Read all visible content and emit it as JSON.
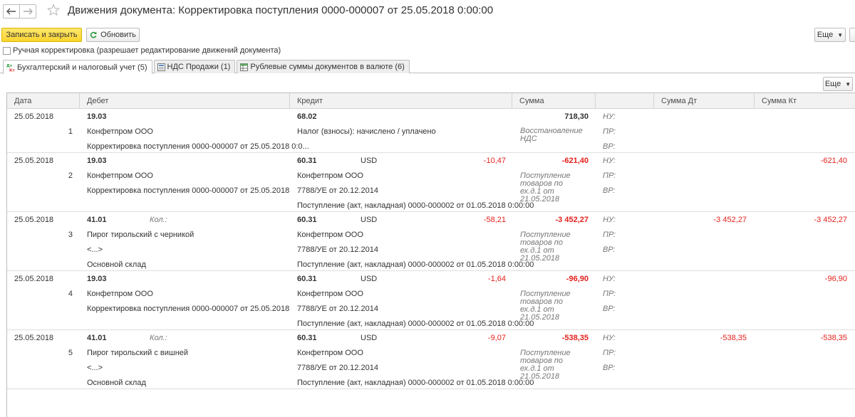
{
  "window": {
    "title": "Движения документа: Корректировка поступления 0000-000007 от 25.05.2018 0:00:00"
  },
  "toolbar": {
    "save_close": "Записать и закрыть",
    "refresh": "Обновить",
    "more": "Еще"
  },
  "manual_correction": {
    "label": "Ручная корректировка (разрешает редактирование движений документа)",
    "checked": false
  },
  "tabs": [
    {
      "label": "Бухгалтерский и налоговый учет (5)",
      "active": true,
      "icon": "accounting-icon"
    },
    {
      "label": "НДС Продажи (1)",
      "active": false,
      "icon": "register-icon"
    },
    {
      "label": "Рублевые суммы документов в валюте (6)",
      "active": false,
      "icon": "table-icon"
    }
  ],
  "table": {
    "more": "Еще",
    "columns": [
      "Дата",
      "Дебет",
      "Кредит",
      "Сумма",
      "",
      "Сумма Дт",
      "Сумма Кт"
    ],
    "rows": [
      {
        "date": "25.05.2018",
        "num": "1",
        "dt_account": "19.03",
        "dt_qty": "",
        "dt_sub": [
          "Конфетпром ООО",
          "Корректировка поступления 0000-000007 от 25.05.2018 0:0..."
        ],
        "kt_account": "68.02",
        "kt_currency": "",
        "kt_cur_amount": "",
        "kt_sub": [
          "Налог (взносы): начислено / уплачено"
        ],
        "amount": "718,30",
        "amount_red": false,
        "content": "Восстановление НДС",
        "nu": "НУ:",
        "pr": "ПР:",
        "vr": "ВР:",
        "sum_dt": "",
        "sum_kt": ""
      },
      {
        "date": "25.05.2018",
        "num": "2",
        "dt_account": "19.03",
        "dt_qty": "",
        "dt_sub": [
          "Конфетпром ООО",
          "Корректировка поступления 0000-000007 от 25.05.2018"
        ],
        "kt_account": "60.31",
        "kt_currency": "USD",
        "kt_cur_amount": "-10,47",
        "kt_sub": [
          "Конфетпром ООО",
          "7788/УЕ от 20.12.2014",
          "Поступление (акт, накладная) 0000-000002 от 01.05.2018 0:00:00"
        ],
        "amount": "-621,40",
        "amount_red": true,
        "content": "Поступление товаров по ех.д.1 от 21.05.2018",
        "nu": "НУ:",
        "pr": "ПР:",
        "vr": "ВР:",
        "sum_dt": "",
        "sum_kt": "-621,40"
      },
      {
        "date": "25.05.2018",
        "num": "3",
        "dt_account": "41.01",
        "dt_qty": "Кол.:",
        "dt_sub": [
          "Пирог тирольский с черникой",
          "<...>",
          "Основной склад"
        ],
        "kt_account": "60.31",
        "kt_currency": "USD",
        "kt_cur_amount": "-58,21",
        "kt_sub": [
          "Конфетпром ООО",
          "7788/УЕ от 20.12.2014",
          "Поступление (акт, накладная) 0000-000002 от 01.05.2018 0:00:00"
        ],
        "amount": "-3 452,27",
        "amount_red": true,
        "content": "Поступление товаров по ех.д.1 от 21.05.2018",
        "nu": "НУ:",
        "pr": "ПР:",
        "vr": "ВР:",
        "sum_dt": "-3 452,27",
        "sum_kt": "-3 452,27"
      },
      {
        "date": "25.05.2018",
        "num": "4",
        "dt_account": "19.03",
        "dt_qty": "",
        "dt_sub": [
          "Конфетпром ООО",
          "Корректировка поступления 0000-000007 от 25.05.2018"
        ],
        "kt_account": "60.31",
        "kt_currency": "USD",
        "kt_cur_amount": "-1,64",
        "kt_sub": [
          "Конфетпром ООО",
          "7788/УЕ от 20.12.2014",
          "Поступление (акт, накладная) 0000-000002 от 01.05.2018 0:00:00"
        ],
        "amount": "-96,90",
        "amount_red": true,
        "content": "Поступление товаров по ех.д.1 от 21.05.2018",
        "nu": "НУ:",
        "pr": "ПР:",
        "vr": "ВР:",
        "sum_dt": "",
        "sum_kt": "-96,90"
      },
      {
        "date": "25.05.2018",
        "num": "5",
        "dt_account": "41.01",
        "dt_qty": "Кол.:",
        "dt_sub": [
          "Пирог тирольский с вишней",
          "<...>",
          "Основной склад"
        ],
        "kt_account": "60.31",
        "kt_currency": "USD",
        "kt_cur_amount": "-9,07",
        "kt_sub": [
          "Конфетпром ООО",
          "7788/УЕ от 20.12.2014",
          "Поступление (акт, накладная) 0000-000002 от 01.05.2018 0:00:00"
        ],
        "amount": "-538,35",
        "amount_red": true,
        "content": "Поступление товаров по ех.д.1 от 21.05.2018",
        "nu": "НУ:",
        "pr": "ПР:",
        "vr": "ВР:",
        "sum_dt": "-538,35",
        "sum_kt": "-538,35"
      }
    ]
  },
  "colors": {
    "primary_button": "#fad42e",
    "negative": "#e3211c",
    "header_bg": "#f2f2f2",
    "border": "#bdbdbd"
  }
}
